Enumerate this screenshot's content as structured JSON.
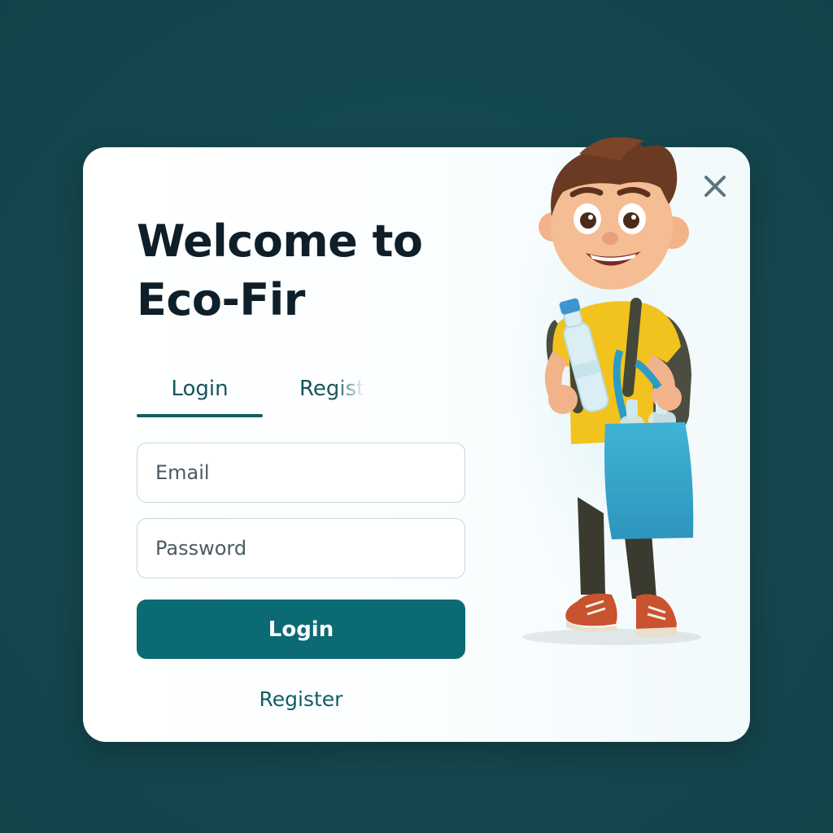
{
  "modal": {
    "title": "Welcome to Eco-Fir",
    "tabs": [
      {
        "label": "Login",
        "active": true
      },
      {
        "label": "Register",
        "active": false
      }
    ],
    "email_placeholder": "Email",
    "password_placeholder": "Password",
    "login_button_label": "Login",
    "register_link_label": "Register",
    "close_icon": "close-icon",
    "illustration": "eco-kid-recycling-mascot"
  },
  "colors": {
    "background": "#13464c",
    "primary": "#0c6a74",
    "tab_text": "#16545c",
    "title_text": "#0f1f2a",
    "field_border": "#c6d8dc"
  }
}
